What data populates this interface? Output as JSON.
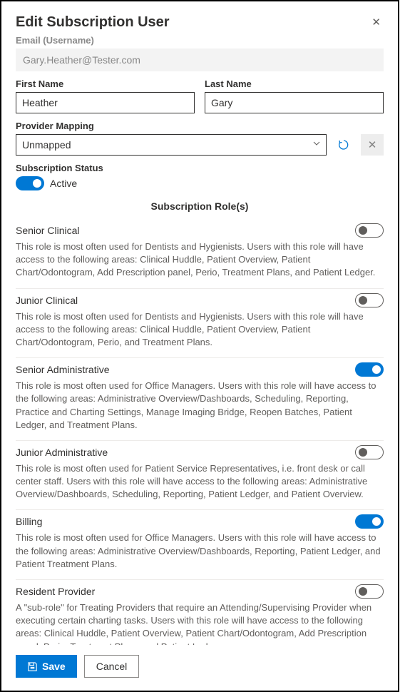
{
  "header": {
    "title": "Edit Subscription User"
  },
  "email": {
    "label": "Email (Username)",
    "value": "Gary.Heather@Tester.com"
  },
  "firstName": {
    "label": "First Name",
    "value": "Heather"
  },
  "lastName": {
    "label": "Last Name",
    "value": "Gary"
  },
  "providerMapping": {
    "label": "Provider Mapping",
    "value": "Unmapped"
  },
  "subscriptionStatus": {
    "label": "Subscription Status",
    "stateLabel": "Active",
    "active": true
  },
  "rolesSection": {
    "title": "Subscription Role(s)"
  },
  "roles": [
    {
      "title": "Senior Clinical",
      "desc": "This role is most often used for Dentists and Hygienists. Users with this role will have access to the following areas: Clinical Huddle, Patient Overview, Patient Chart/Odontogram, Add Prescription panel, Perio, Treatment Plans, and Patient Ledger.",
      "enabled": false
    },
    {
      "title": "Junior Clinical",
      "desc": "This role is most often used for Dentists and Hygienists. Users with this role will have access to the following areas: Clinical Huddle, Patient Overview, Patient Chart/Odontogram, Perio, and Treatment Plans.",
      "enabled": false
    },
    {
      "title": "Senior Administrative",
      "desc": "This role is most often used for Office Managers. Users with this role will have access to the following areas: Administrative Overview/Dashboards, Scheduling, Reporting, Practice and Charting Settings, Manage Imaging Bridge, Reopen Batches, Patient Ledger, and Treatment Plans.",
      "enabled": true
    },
    {
      "title": "Junior Administrative",
      "desc": "This role is most often used for Patient Service Representatives, i.e. front desk or call center staff. Users with this role will have access to the following areas: Administrative Overview/Dashboards, Scheduling, Reporting, Patient Ledger, and Patient Overview.",
      "enabled": false
    },
    {
      "title": "Billing",
      "desc": "This role is most often used for Office Managers. Users with this role will have access to the following areas: Administrative Overview/Dashboards, Reporting, Patient Ledger, and Patient Treatment Plans.",
      "enabled": true
    },
    {
      "title": "Resident Provider",
      "desc": "A \"sub-role\" for Treating Providers that require an Attending/Supervising Provider when executing certain charting tasks. Users with this role will have access to the following areas: Clinical Huddle, Patient Overview, Patient Chart/Odontogram, Add Prescription panel, Perio, Treatment Plans, and Patient Ledger.",
      "enabled": false
    }
  ],
  "footer": {
    "save": "Save",
    "cancel": "Cancel"
  }
}
